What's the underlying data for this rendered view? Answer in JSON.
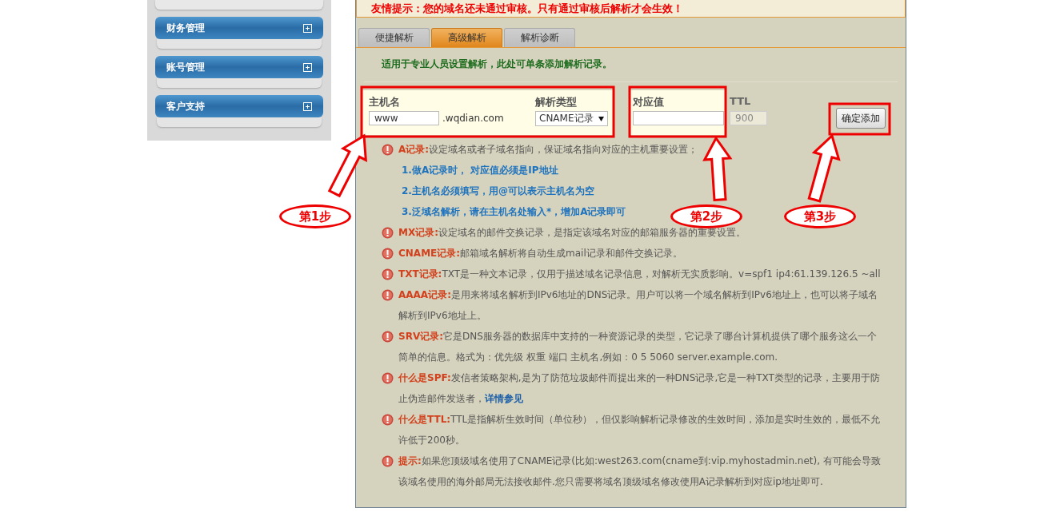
{
  "sidebar": {
    "items": [
      {
        "label": "财务管理",
        "expanded": false
      },
      {
        "label": "账号管理",
        "expanded": false
      },
      {
        "label": "客户支持",
        "expanded": false
      }
    ]
  },
  "notice": "友情提示：您的域名还未通过审核。只有通过审核后解析才会生效！",
  "tabs": [
    {
      "label": "便捷解析",
      "selected": false
    },
    {
      "label": "高级解析",
      "selected": true
    },
    {
      "label": "解析诊断",
      "selected": false
    }
  ],
  "hint": "适用于专业人员设置解析，此处可单条添加解析记录。",
  "form": {
    "host_label": "主机名",
    "host_value": "www",
    "domain_suffix": ".wqdian.com",
    "type_label": "解析类型",
    "type_value": "CNAME记录",
    "value_label": "对应值",
    "ttl_label": "TTL",
    "ttl_value": "900",
    "ttl_disabled": true,
    "submit": "确定添加"
  },
  "notes": [
    {
      "label": "A记录:",
      "text": "设定域名或者子域名指向，保证域名指向对应的主机重要设置；",
      "tips": [
        "1.做A记录时， 对应值必须是IP地址",
        "2.主机名必须填写，用@可以表示主机名为空",
        "3.泛域名解析，请在主机名处输入*，增加A记录即可"
      ]
    },
    {
      "label": "MX记录:",
      "text": "设定域名的邮件交换记录，是指定该域名对应的邮箱服务器的重要设置。"
    },
    {
      "label": "CNAME记录:",
      "text": "邮箱域名解析将自动生成mail记录和邮件交换记录。"
    },
    {
      "label": "TXT记录:",
      "text": "TXT是一种文本记录，仅用于描述域名记录信息，对解析无实质影响。v=spf1 ip4:61.139.126.5 ~all"
    },
    {
      "label": "AAAA记录:",
      "text": "是用来将域名解析到IPv6地址的DNS记录。用户可以将一个域名解析到IPv6地址上，也可以将子域名解析到IPv6地址上。"
    },
    {
      "label": "SRV记录:",
      "text": "它是DNS服务器的数据库中支持的一种资源记录的类型，它记录了哪台计算机提供了哪个服务这么一个简单的信息。格式为：优先级 权重 端口 主机名,例如：0 5 5060 server.example.com."
    },
    {
      "label": "什么是SPF:",
      "text": "发信者策略架构,是为了防范垃圾邮件而提出来的一种DNS记录,它是一种TXT类型的记录，主要用于防止伪造邮件发送者，",
      "link": "详情参见"
    },
    {
      "label": "什么是TTL:",
      "text": "TTL是指解析生效时间（单位秒），但仅影响解析记录修改的生效时间，添加是实时生效的，最低不允许低于200秒。"
    },
    {
      "label": "提示:",
      "text": "如果您顶级域名使用了CNAME记录(比如:west263.com(cname到:vip.myhostadmin.net), 有可能会导致该域名使用的海外邮局无法接收邮件.您只需要将域名顶级域名修改使用A记录解析到对应ip地址即可."
    }
  ],
  "steps": [
    "第1步",
    "第2步",
    "第3步"
  ]
}
